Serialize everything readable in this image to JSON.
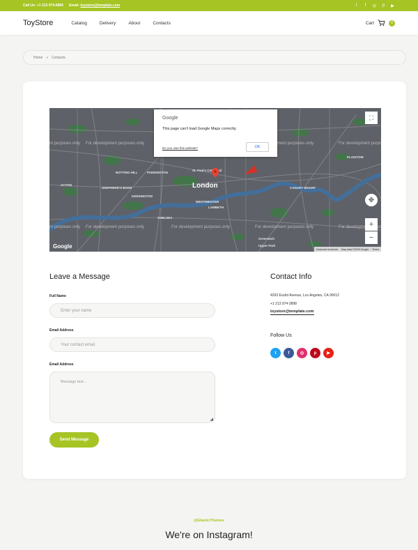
{
  "topbar": {
    "call_label": "Call Us: +1 213 974-6866",
    "email_prefix": "Email:",
    "email": "toystore@template.com",
    "social_icons": [
      "twitter-icon",
      "facebook-icon",
      "instagram-icon",
      "pinterest-icon",
      "youtube-icon"
    ]
  },
  "header": {
    "logo": "ToyStore",
    "nav": [
      "Catalog",
      "Delivery",
      "About",
      "Contacts"
    ],
    "cart_label": "Cart",
    "cart_count": "0"
  },
  "breadcrumb": {
    "home": "Home",
    "separator": "»",
    "current": "Contacts"
  },
  "map": {
    "dialog_brand": "Google",
    "dialog_message": "This page can't load Google Maps correctly.",
    "dialog_link": "Do you own this website?",
    "dialog_button": "OK",
    "watermark": "For development purposes only",
    "city": "London",
    "labels": [
      "NOTTING HILL",
      "PADDINGTON",
      "SHEPHERD'S BUSH",
      "KENSINGTON",
      "CHELSEA",
      "WESTMINSTER",
      "LAMBETH",
      "CANARY WHARF",
      "PLAISTOW",
      "ACTON",
      "St. Paul's Cathedral",
      "Upper Park",
      "Greenwich"
    ],
    "attribution": [
      "Keyboard shortcuts",
      "Map data ©2025 Google",
      "Terms"
    ],
    "google_logo": "Google"
  },
  "form": {
    "title": "Leave a Message",
    "name_label": "Full Name",
    "name_placeholder": "Enter your name",
    "email_label": "Email Address",
    "email_placeholder": "Your contact email",
    "message_label": "Email Address",
    "message_placeholder": "Message text...",
    "submit": "Send Message"
  },
  "contact": {
    "title": "Contact Info",
    "address": "4293  Euclid Avenue, Los Angeles, CA 90012",
    "phone": "+1 213 974-3898",
    "email": "toystore@template.com",
    "follow_title": "Follow Us",
    "socials": [
      {
        "icon": "twitter-icon",
        "glyph": "t",
        "color": "#1da1f2"
      },
      {
        "icon": "facebook-icon",
        "glyph": "f",
        "color": "#3b5998"
      },
      {
        "icon": "instagram-icon",
        "glyph": "◎",
        "color": "#e1306c"
      },
      {
        "icon": "pinterest-icon",
        "glyph": "p",
        "color": "#bd081c"
      },
      {
        "icon": "youtube-icon",
        "glyph": "▶",
        "color": "#e62117"
      }
    ]
  },
  "footer": {
    "handle": "@ElasticThemes",
    "title": "We're on Instagram!"
  },
  "colors": {
    "accent": "#a6c424"
  }
}
